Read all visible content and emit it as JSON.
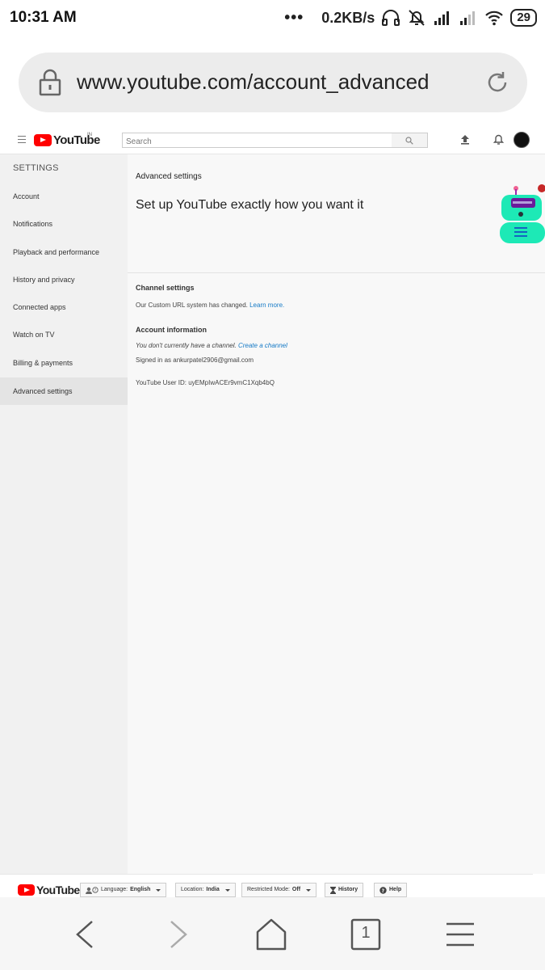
{
  "status_bar": {
    "time": "10:31 AM",
    "dots": "•••",
    "net_speed": "0.2KB/s",
    "battery": "29",
    "icons": [
      "headphones-icon",
      "mute-bell-icon",
      "signal-icon",
      "signal-icon-2",
      "wifi-icon",
      "battery-icon"
    ]
  },
  "browser": {
    "url": "www.youtube.com/account_advanced",
    "nav_icons": [
      "back-icon",
      "forward-icon",
      "home-icon",
      "tabs-icon",
      "menu-icon"
    ],
    "tab_count": "1"
  },
  "header": {
    "logo_text": "YouTube",
    "country": "IN",
    "search_placeholder": "Search"
  },
  "sidebar": {
    "heading": "SETTINGS",
    "items": [
      {
        "label": "Account"
      },
      {
        "label": "Notifications"
      },
      {
        "label": "Playback and performance"
      },
      {
        "label": "History and privacy"
      },
      {
        "label": "Connected apps"
      },
      {
        "label": "Watch on TV"
      },
      {
        "label": "Billing & payments"
      },
      {
        "label": "Advanced settings"
      }
    ]
  },
  "main": {
    "banner_label": "Advanced settings",
    "banner_title": "Set up YouTube exactly how you want it",
    "channel": {
      "title": "Channel settings",
      "text": "Our Custom URL system has changed.",
      "link": "Learn more."
    },
    "account": {
      "title": "Account information",
      "no_channel_text": "You don't currently have a channel.",
      "create_link": "Create a channel",
      "signed_in": "Signed in as ankurpatel2906@gmail.com",
      "user_id": "YouTube User ID: uyEMpIwACEr9vmC1Xqb4bQ"
    }
  },
  "footer": {
    "logo_text": "YouTube",
    "language_label": "Language:",
    "language_value": "English",
    "location_label": "Location:",
    "location_value": "India",
    "restricted_label": "Restricted Mode:",
    "restricted_value": "Off",
    "history": "History",
    "help": "Help"
  }
}
